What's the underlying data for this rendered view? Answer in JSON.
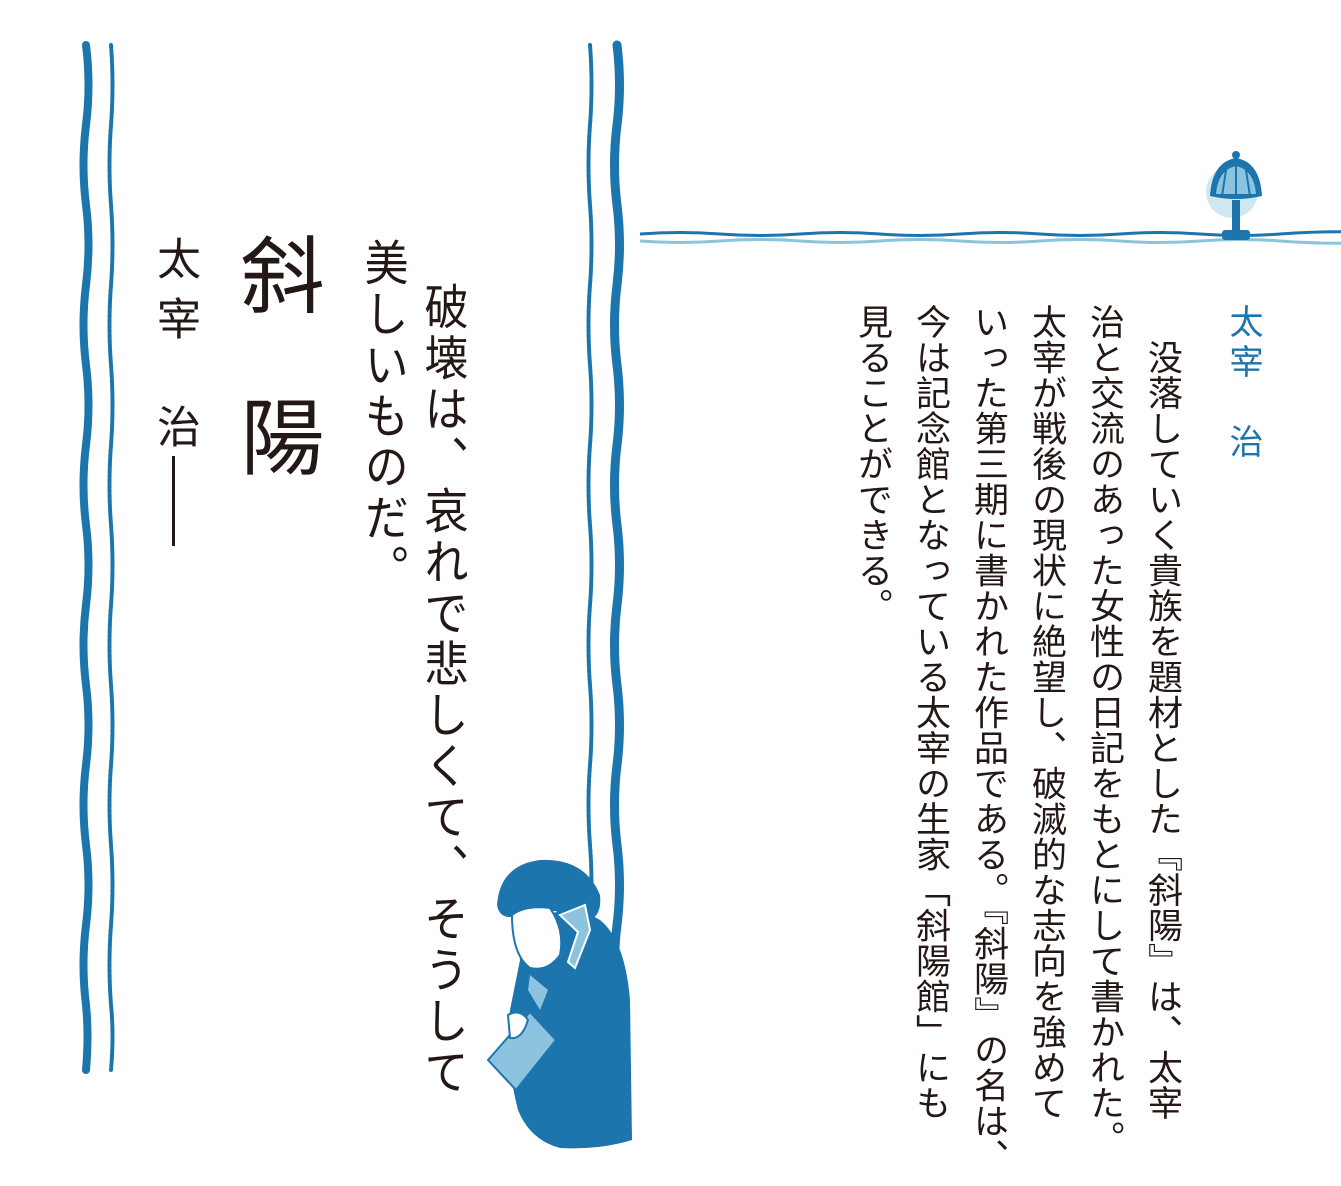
{
  "quote": {
    "line_1": "破壊は、哀れで悲しくて、そうして",
    "line_2": "美しいものだ。"
  },
  "book_title": "斜陽",
  "author_left": {
    "family_name": "太宰",
    "given_name": "治"
  },
  "author_right": {
    "family_name": "太宰",
    "given_name": "治"
  },
  "body": {
    "lines": [
      "　没落していく貴族を題材とした『斜陽』は、太宰",
      "治と交流のあった女性の日記をもとにして書かれた。",
      "太宰が戦後の現状に絶望し、破滅的な志向を強めて",
      "いった第三期に書かれた作品である。『斜陽』の名は、",
      "今は記念館となっている太宰の生家「斜陽館」にも",
      "見ることができる。"
    ]
  },
  "colors": {
    "accent_blue": "#1d75ad",
    "light_blue": "#8cc4e0",
    "text": "#231815"
  },
  "icons": {
    "lamp": "lamp-icon",
    "woman_illustration": "woman-reading-illustration"
  }
}
